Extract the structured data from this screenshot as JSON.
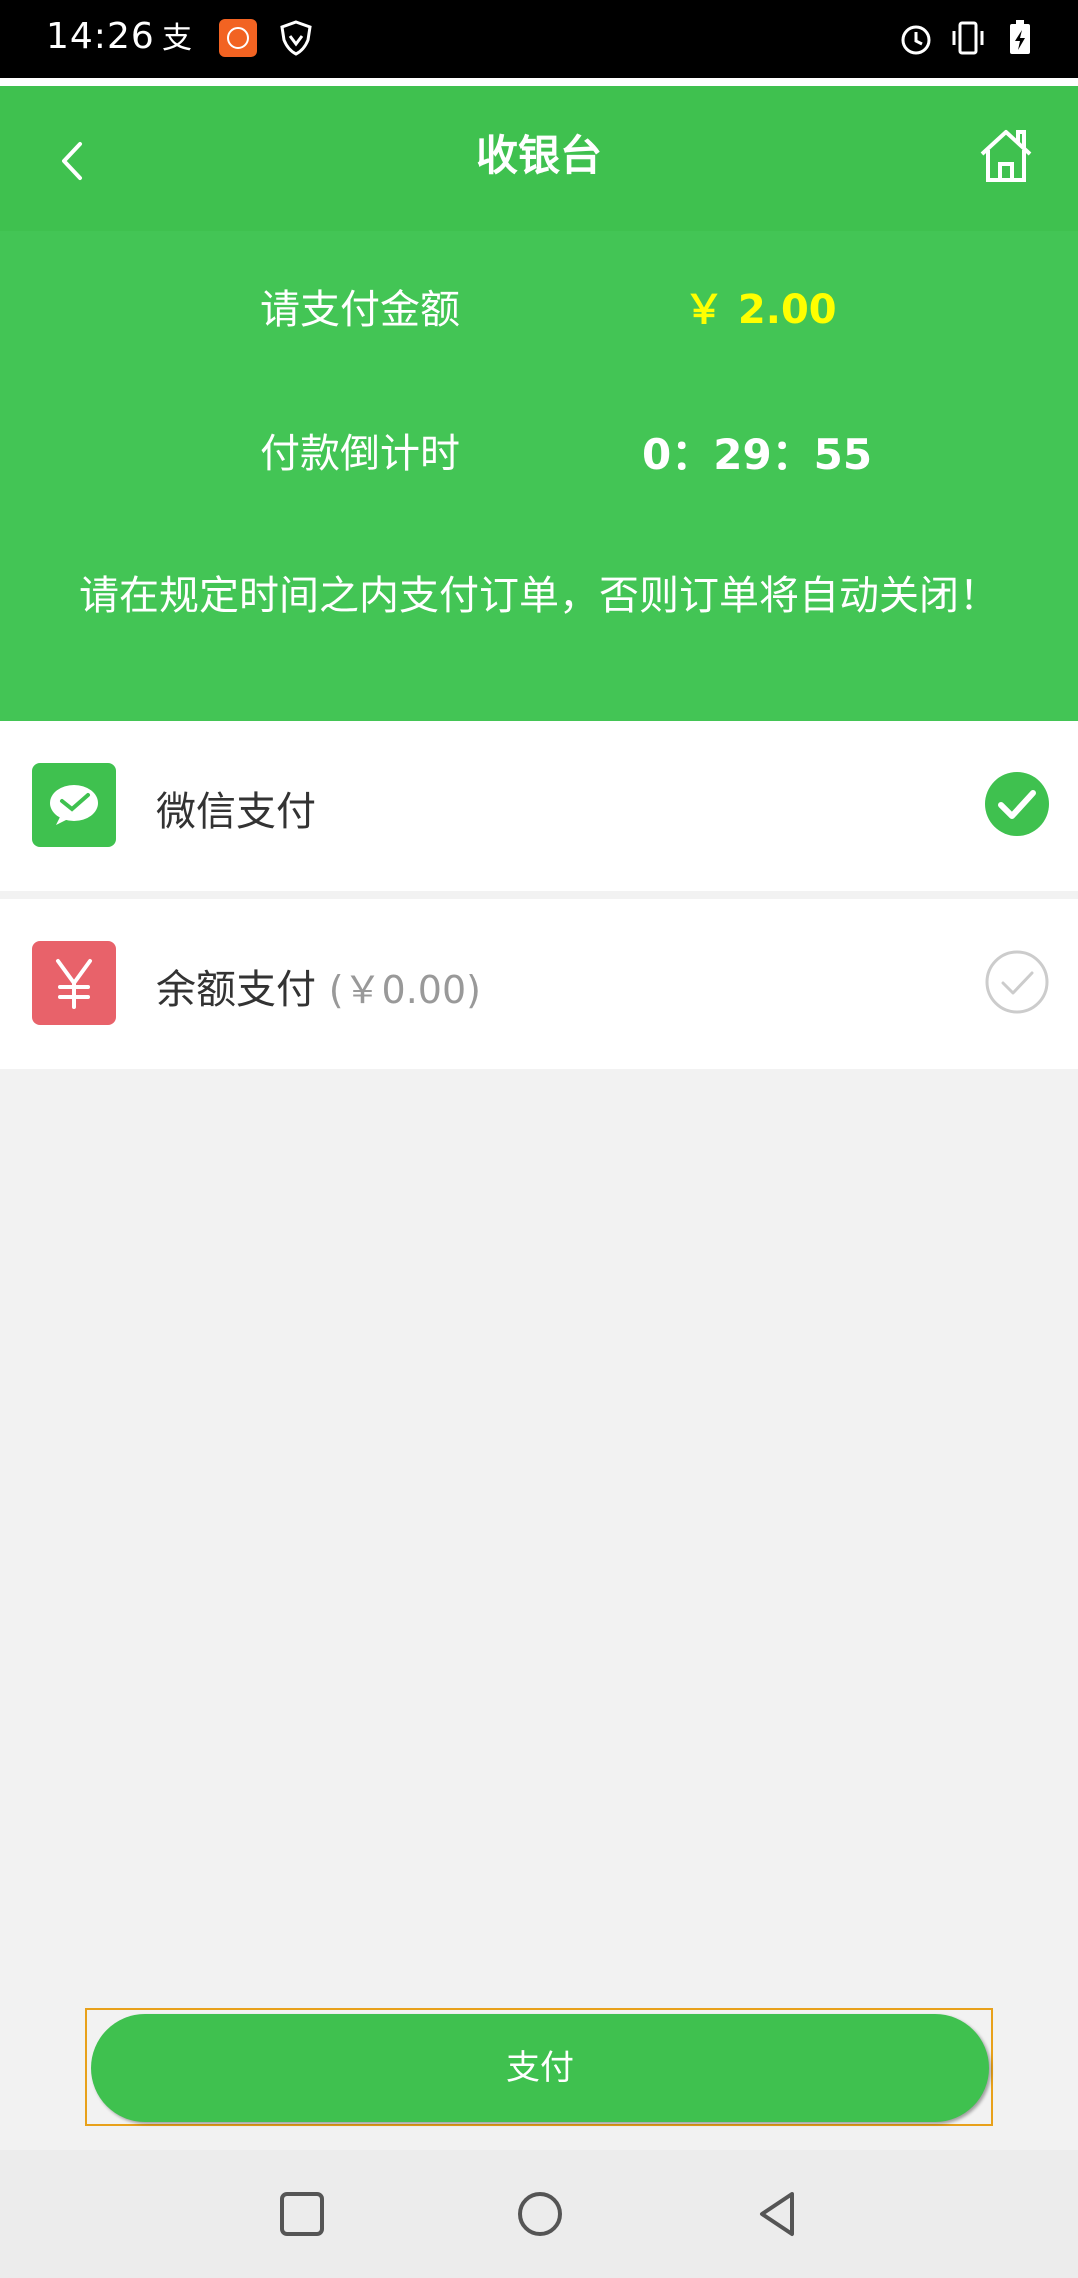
{
  "status_bar": {
    "time": "14:26",
    "left_icons": [
      "alipay-icon",
      "app-badge-icon",
      "shield-icon"
    ],
    "right_icons": [
      "alarm-icon",
      "vibrate-icon",
      "battery-charging-icon"
    ]
  },
  "header": {
    "title": "收银台",
    "back_icon": "chevron-left-icon",
    "home_icon": "home-icon"
  },
  "summary": {
    "amount_label": "请支付金额",
    "amount_value": "￥ 2.00",
    "countdown_label": "付款倒计时",
    "countdown_value": "0：29：55",
    "notice": "请在规定时间之内支付订单，否则订单将自动关闭！"
  },
  "payment_options": [
    {
      "label": "微信支付",
      "icon": "wechat-pay-icon",
      "selected": true
    },
    {
      "label": "余额支付",
      "balance": "(￥0.00)",
      "icon": "yuan-icon",
      "selected": false
    }
  ],
  "pay_button": {
    "label": "支付"
  },
  "colors": {
    "brand_green": "#3fc14f",
    "amount_yellow": "#ffff00",
    "balance_red": "#e8626a",
    "focus_border": "#e8a11b"
  }
}
